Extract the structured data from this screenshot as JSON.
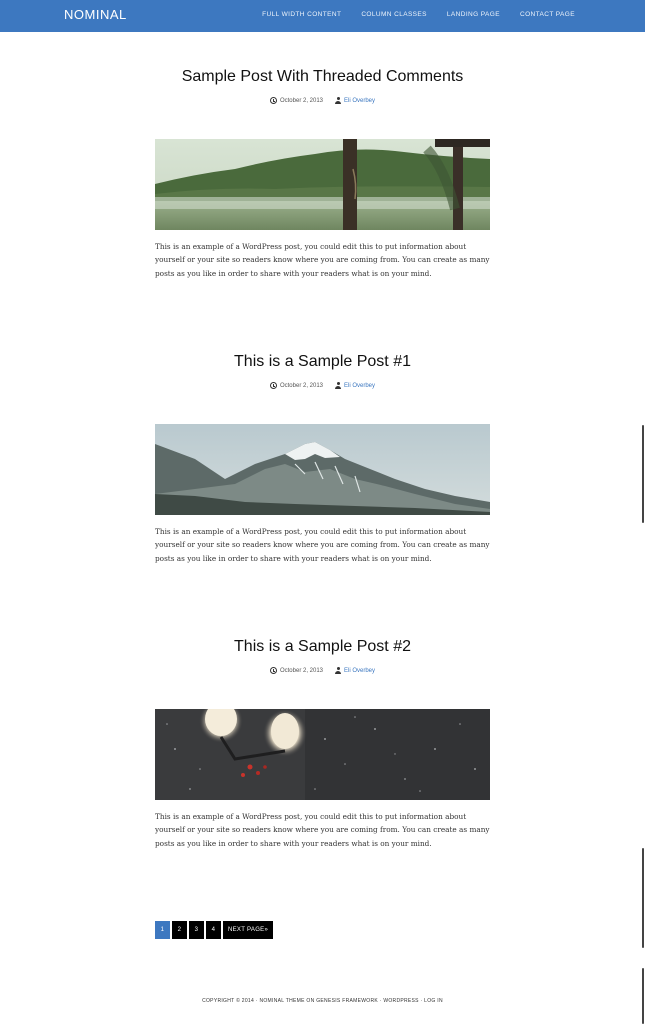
{
  "site": {
    "title": "NOMINAL"
  },
  "nav": [
    {
      "label": "FULL WIDTH CONTENT"
    },
    {
      "label": "COLUMN CLASSES"
    },
    {
      "label": "LANDING PAGE"
    },
    {
      "label": "CONTACT PAGE"
    }
  ],
  "posts": [
    {
      "title": "Sample Post With Threaded Comments",
      "date": "October 2, 2013",
      "author": "Eli Overbey",
      "excerpt": "This is an example of a WordPress post, you could edit this to put information about yourself or your site so readers know where you are coming from. You can create as many posts as you like in order to share with your readers what is on your mind."
    },
    {
      "title": "This is a Sample Post #1",
      "date": "October 2, 2013",
      "author": "Eli Overbey",
      "excerpt": "This is an example of a WordPress post, you could edit this to put information about yourself or your site so readers know where you are coming from. You can create as many posts as you like in order to share with your readers what is on your mind."
    },
    {
      "title": "This is a Sample Post #2",
      "date": "October 2, 2013",
      "author": "Eli Overbey",
      "excerpt": "This is an example of a WordPress post, you could edit this to put information about yourself or your site so readers know where you are coming from. You can create as many posts as you like in order to share with your readers what is on your mind."
    }
  ],
  "pagination": {
    "pages": [
      "1",
      "2",
      "3",
      "4"
    ],
    "current": "1",
    "next_label": "NEXT PAGE»"
  },
  "footer": {
    "text": "COPYRIGHT © 2014 · NOMINAL THEME ON GENESIS FRAMEWORK · WORDPRESS · LOG IN"
  },
  "colors": {
    "accent": "#3d78c0",
    "page_button": "#000000"
  }
}
